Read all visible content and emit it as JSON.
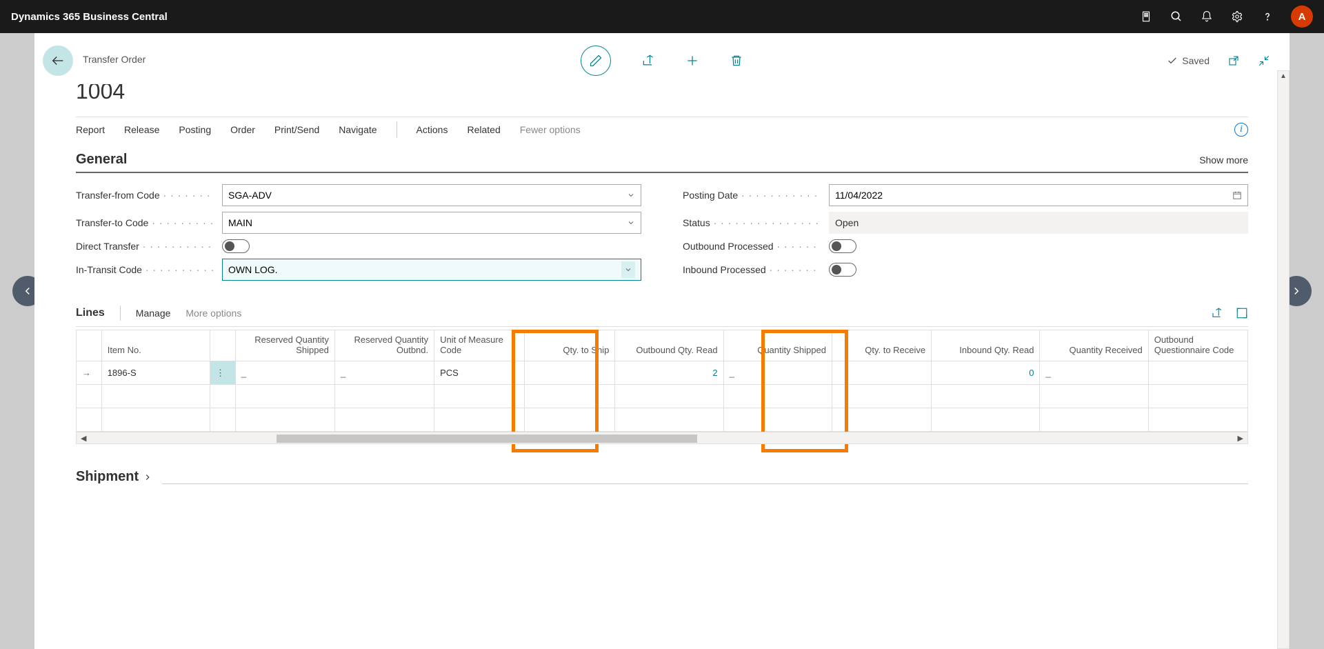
{
  "app": {
    "title": "Dynamics 365 Business Central",
    "avatar_initial": "A"
  },
  "header": {
    "record_type": "Transfer Order",
    "record_no": "1004",
    "saved_label": "Saved"
  },
  "actions": {
    "report": "Report",
    "release": "Release",
    "posting": "Posting",
    "order": "Order",
    "print_send": "Print/Send",
    "navigate": "Navigate",
    "actions": "Actions",
    "related": "Related",
    "fewer": "Fewer options"
  },
  "general": {
    "title": "General",
    "show_more": "Show more",
    "fields": {
      "transfer_from_code": {
        "label": "Transfer-from Code",
        "value": "SGA-ADV"
      },
      "transfer_to_code": {
        "label": "Transfer-to Code",
        "value": "MAIN"
      },
      "direct_transfer": {
        "label": "Direct Transfer",
        "value": false
      },
      "in_transit_code": {
        "label": "In-Transit Code",
        "value": "OWN LOG."
      },
      "posting_date": {
        "label": "Posting Date",
        "value": "11/04/2022"
      },
      "status": {
        "label": "Status",
        "value": "Open"
      },
      "outbound_processed": {
        "label": "Outbound Processed",
        "value": false
      },
      "inbound_processed": {
        "label": "Inbound Processed",
        "value": false
      }
    }
  },
  "lines": {
    "title": "Lines",
    "manage": "Manage",
    "more_options": "More options",
    "columns": {
      "item_no": "Item No.",
      "reserved_qty_shipped": "Reserved Quantity Shipped",
      "reserved_qty_outbnd": "Reserved Quantity Outbnd.",
      "uom": "Unit of Measure Code",
      "qty_to_ship": "Qty. to Ship",
      "outbound_qty_read": "Outbound Qty. Read",
      "qty_shipped": "Quantity Shipped",
      "qty_to_receive": "Qty. to Receive",
      "inbound_qty_read": "Inbound Qty. Read",
      "qty_received": "Quantity Received",
      "outbound_questionnaire": "Outbound Questionnaire Code"
    },
    "rows": [
      {
        "item_no": "1896-S",
        "reserved_qty_shipped": "_",
        "reserved_qty_outbnd": "_",
        "uom": "PCS",
        "qty_to_ship": "",
        "outbound_qty_read": "2",
        "qty_shipped": "_",
        "qty_to_receive": "",
        "inbound_qty_read": "0",
        "qty_received": "_",
        "outbound_questionnaire": ""
      }
    ]
  },
  "shipment": {
    "title": "Shipment"
  }
}
